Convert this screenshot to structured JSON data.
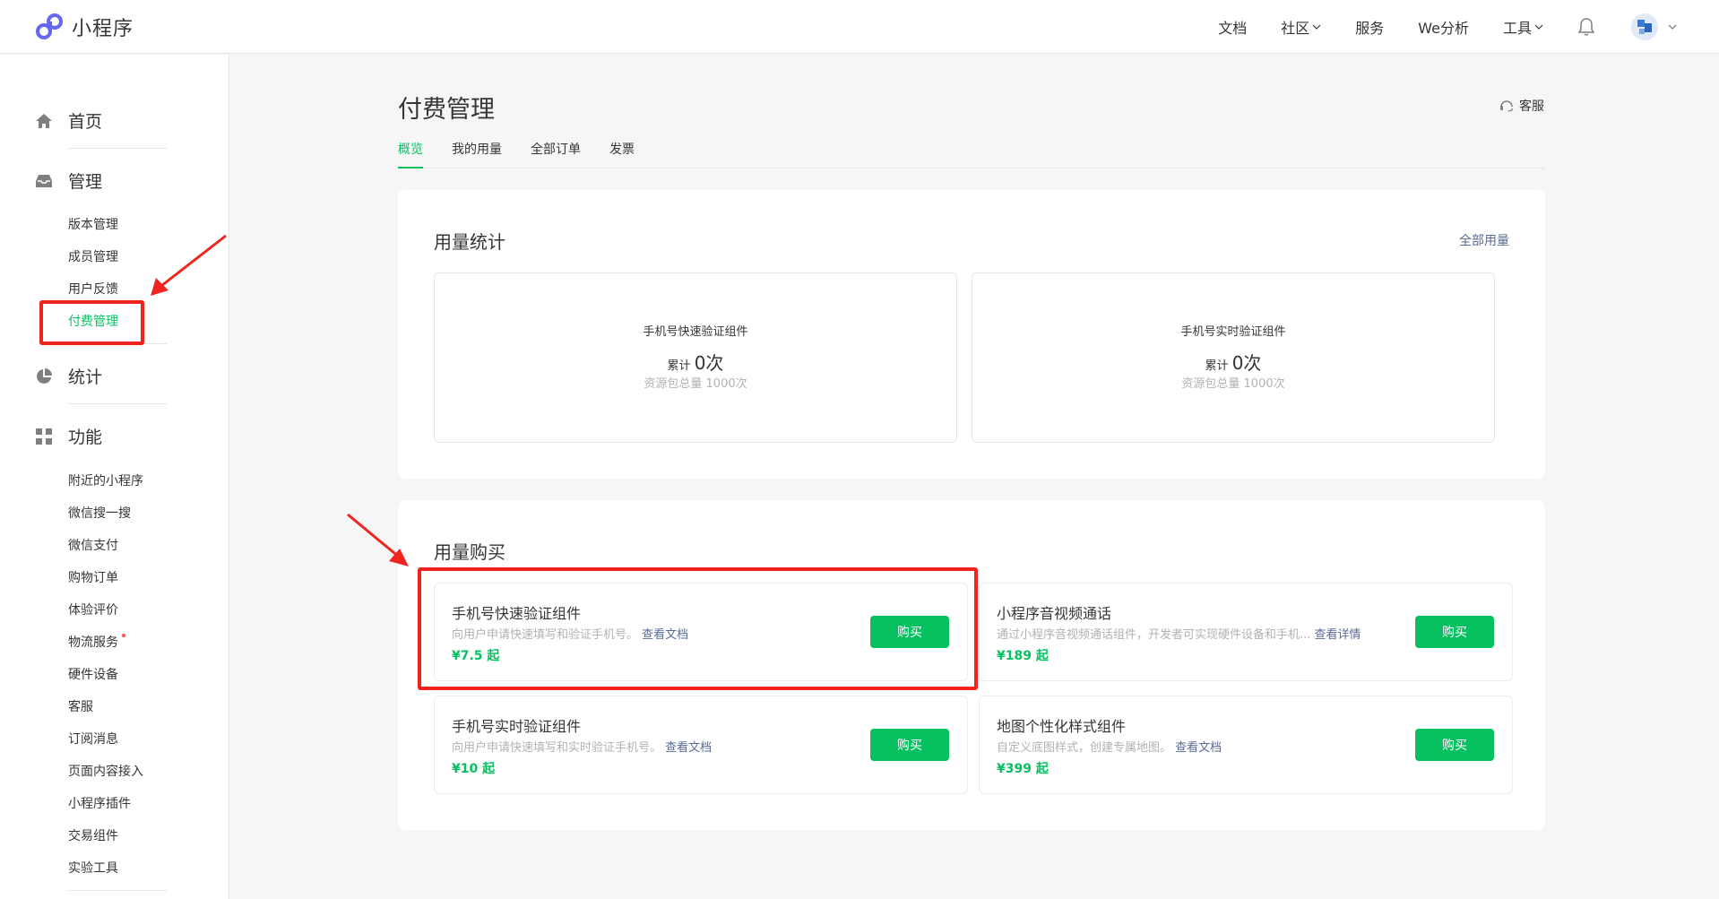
{
  "header": {
    "app_name": "小程序",
    "nav": {
      "docs": "文档",
      "community": "社区",
      "services": "服务",
      "analytics": "We分析",
      "tools": "工具"
    }
  },
  "sidebar": {
    "home": "首页",
    "manage": "管理",
    "manage_items": [
      "版本管理",
      "成员管理",
      "用户反馈",
      "付费管理"
    ],
    "stats": "统计",
    "features": "功能",
    "feature_items": [
      "附近的小程序",
      "微信搜一搜",
      "微信支付",
      "购物订单",
      "体验评价",
      "物流服务",
      "硬件设备",
      "客服",
      "订阅消息",
      "页面内容接入",
      "小程序插件",
      "交易组件",
      "实验工具"
    ]
  },
  "page": {
    "title": "付费管理",
    "service_label": "客服",
    "tabs": [
      "概览",
      "我的用量",
      "全部订单",
      "发票"
    ]
  },
  "usage_stats": {
    "title": "用量统计",
    "all_usage_link": "全部用量",
    "items": [
      {
        "name": "手机号快速验证组件",
        "cum_label": "累计",
        "count": "0次",
        "total": "资源包总量 1000次"
      },
      {
        "name": "手机号实时验证组件",
        "cum_label": "累计",
        "count": "0次",
        "total": "资源包总量 1000次"
      }
    ]
  },
  "purchase": {
    "title": "用量购买",
    "buy_label": "购买",
    "products": [
      {
        "name": "手机号快速验证组件",
        "desc": "向用户申请快速填写和验证手机号。",
        "link": "查看文档",
        "price": "¥7.5 起"
      },
      {
        "name": "小程序音视频通话",
        "desc": "通过小程序音视频通话组件，开发者可实现硬件设备和手机...",
        "link": "查看详情",
        "price": "¥189 起"
      },
      {
        "name": "手机号实时验证组件",
        "desc": "向用户申请快速填写和实时验证手机号。",
        "link": "查看文档",
        "price": "¥10 起"
      },
      {
        "name": "地图个性化样式组件",
        "desc": "自定义底图样式，创建专属地图。",
        "link": "查看文档",
        "price": "¥399 起"
      }
    ]
  },
  "colors": {
    "accent": "#07c160",
    "link": "#576b95",
    "annotation": "#f0241e"
  }
}
